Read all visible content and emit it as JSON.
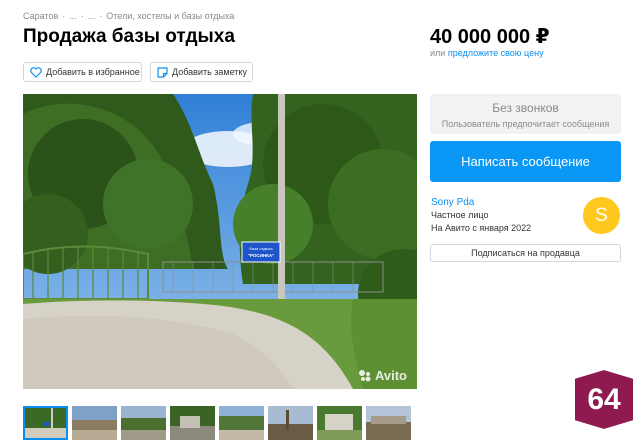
{
  "breadcrumb": {
    "items": [
      "Саратов",
      "...",
      "...",
      "Отели, хостелы и базы отдыха"
    ],
    "separator": "·"
  },
  "title": "Продажа базы отдыха",
  "actions": {
    "favorite_label": "Добавить в избранное",
    "note_label": "Добавить заметку",
    "favorite_icon": "heart-icon",
    "note_icon": "note-icon"
  },
  "photo": {
    "sign_line1": "База отдыха",
    "sign_line2": "\"РОСИНКА\"",
    "watermark": "Avito",
    "thumbnail_count": 8,
    "active_thumbnail": 0
  },
  "price": {
    "value": "40 000 000 ₽",
    "or_label": "или",
    "offer_link": "предложите свою цену"
  },
  "contact": {
    "no_calls_title": "Без звонков",
    "no_calls_subtitle": "Пользователь предпочитает сообщения",
    "write_button": "Написать сообщение"
  },
  "seller": {
    "name": "Sony Pda",
    "type": "Частное лицо",
    "since": "На Авито с января 2022",
    "avatar_letter": "S",
    "subscribe_button": "Подписаться на продавца"
  },
  "region_badge": "64",
  "colors": {
    "accent": "#0a97f5",
    "link": "#0a8ff0",
    "avatar": "#ffc81f",
    "badge": "#8e1a4f"
  }
}
